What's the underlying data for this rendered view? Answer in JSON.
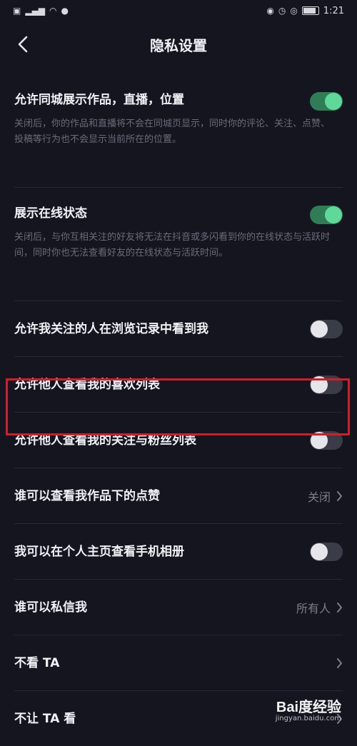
{
  "status_bar": {
    "time": "1:21"
  },
  "nav": {
    "title": "隐私设置"
  },
  "settings": [
    {
      "title": "允许同城展示作品，直播，位置",
      "desc": "关闭后，你的作品和直播将不会在同城页显示，同时你的评论、关注、点赞、投稿等行为也不会显示当前所在的位置。",
      "toggle": "on"
    },
    {
      "title": "展示在线状态",
      "desc": "关闭后，与你互相关注的好友将无法在抖音或多闪看到你的在线状态与活跃时间，同时你也无法查看好友的在线状态与活跃时间。",
      "toggle": "on"
    },
    {
      "title": "允许我关注的人在浏览记录中看到我",
      "toggle": "off"
    },
    {
      "title": "允许他人查看我的喜欢列表",
      "toggle": "off"
    },
    {
      "title": "允许他人查看我的关注与粉丝列表",
      "toggle": "off"
    },
    {
      "title": "谁可以查看我作品下的点赞",
      "value": "关闭"
    },
    {
      "title": "我可以在个人主页查看手机相册",
      "toggle": "off"
    },
    {
      "title": "谁可以私信我",
      "value": "所有人"
    },
    {
      "title": "不看 TA"
    },
    {
      "title": "不让 TA 看"
    }
  ],
  "watermark": {
    "logo": "Bai度经验",
    "url": "jingyan.baidu.com"
  },
  "colors": {
    "background": "#14151f",
    "toggle_on": "#5ed99a",
    "highlight": "#d41d2b"
  }
}
